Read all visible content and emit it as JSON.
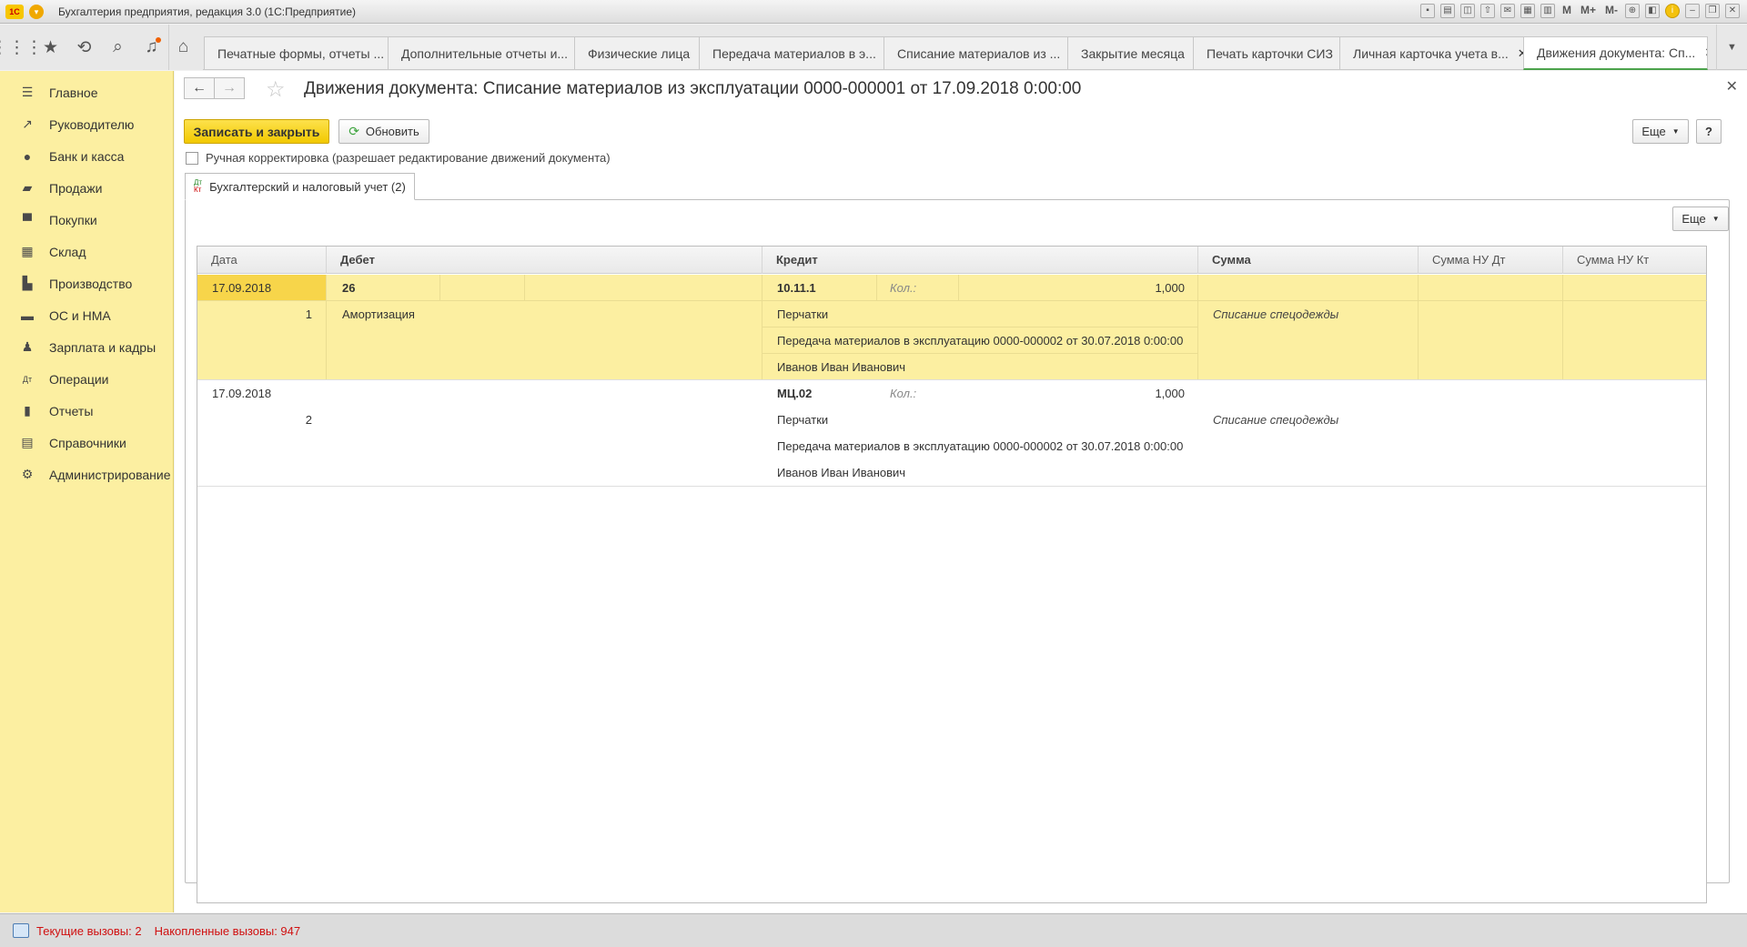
{
  "window": {
    "title": "Бухгалтерия предприятия, редакция 3.0  (1С:Предприятие)",
    "logo": "1С",
    "toolbar_labels": [
      "M",
      "M+",
      "M-"
    ]
  },
  "top_toolbar": {
    "icons": [
      "apps-grid-icon",
      "favorites-star-icon",
      "history-icon",
      "search-icon",
      "notifications-bell-icon"
    ],
    "home_icon": "home-icon"
  },
  "tabs": [
    {
      "label": "Печатные формы, отчеты ..."
    },
    {
      "label": "Дополнительные отчеты и..."
    },
    {
      "label": "Физические лица"
    },
    {
      "label": "Передача материалов в э..."
    },
    {
      "label": "Списание материалов из ..."
    },
    {
      "label": "Закрытие месяца"
    },
    {
      "label": "Печать карточки СИЗ"
    },
    {
      "label": "Личная карточка учета в..."
    },
    {
      "label": "Движения документа: Сп..."
    }
  ],
  "sidebar": {
    "items": [
      {
        "label": "Главное",
        "icon": "menu-lines-icon"
      },
      {
        "label": "Руководителю",
        "icon": "trend-chart-icon"
      },
      {
        "label": "Банк и касса",
        "icon": "coin-icon"
      },
      {
        "label": "Продажи",
        "icon": "shopping-bag-icon"
      },
      {
        "label": "Покупки",
        "icon": "cart-icon"
      },
      {
        "label": "Склад",
        "icon": "warehouse-icon"
      },
      {
        "label": "Производство",
        "icon": "factory-icon"
      },
      {
        "label": "ОС и НМА",
        "icon": "truck-icon"
      },
      {
        "label": "Зарплата и кадры",
        "icon": "person-icon"
      },
      {
        "label": "Операции",
        "icon": "dt-kt-icon"
      },
      {
        "label": "Отчеты",
        "icon": "bar-chart-icon"
      },
      {
        "label": "Справочники",
        "icon": "books-icon"
      },
      {
        "label": "Администрирование",
        "icon": "gear-icon"
      }
    ]
  },
  "form": {
    "title": "Движения документа: Списание материалов из эксплуатации 0000-000001 от 17.09.2018 0:00:00",
    "save_close": "Записать и закрыть",
    "refresh": "Обновить",
    "more": "Еще",
    "help": "?",
    "manual_correction": "Ручная корректировка (разрешает редактирование движений документа)",
    "subtab": "Бухгалтерский и налоговый учет (2)",
    "subtab_icon_top": "Дт",
    "subtab_icon_bottom": "Кт",
    "panel_more": "Еще"
  },
  "table": {
    "columns": [
      "Дата",
      "Дебет",
      "Кредит",
      "Сумма",
      "Сумма НУ Дт",
      "Сумма НУ Кт"
    ],
    "rows": [
      {
        "date": "17.09.2018",
        "num": "1",
        "debit_account": "26",
        "debit_sub": "Амортизация",
        "credit_account": "10.11.1",
        "qty_label": "Кол.:",
        "qty": "1,000",
        "credit_sub1": "Перчатки",
        "credit_sub2": "Передача материалов в эксплуатацию 0000-000002 от 30.07.2018 0:00:00",
        "credit_sub3": "Иванов Иван Иванович",
        "content": "Списание спецодежды"
      },
      {
        "date": "17.09.2018",
        "num": "2",
        "debit_account": "",
        "debit_sub": "",
        "credit_account": "МЦ.02",
        "qty_label": "Кол.:",
        "qty": "1,000",
        "credit_sub1": "Перчатки",
        "credit_sub2": "Передача материалов в эксплуатацию 0000-000002 от 30.07.2018 0:00:00",
        "credit_sub3": "Иванов Иван Иванович",
        "content": "Списание спецодежды"
      }
    ]
  },
  "status": {
    "current_calls": "Текущие вызовы: 2",
    "accumulated_calls": "Накопленные вызовы: 947"
  }
}
